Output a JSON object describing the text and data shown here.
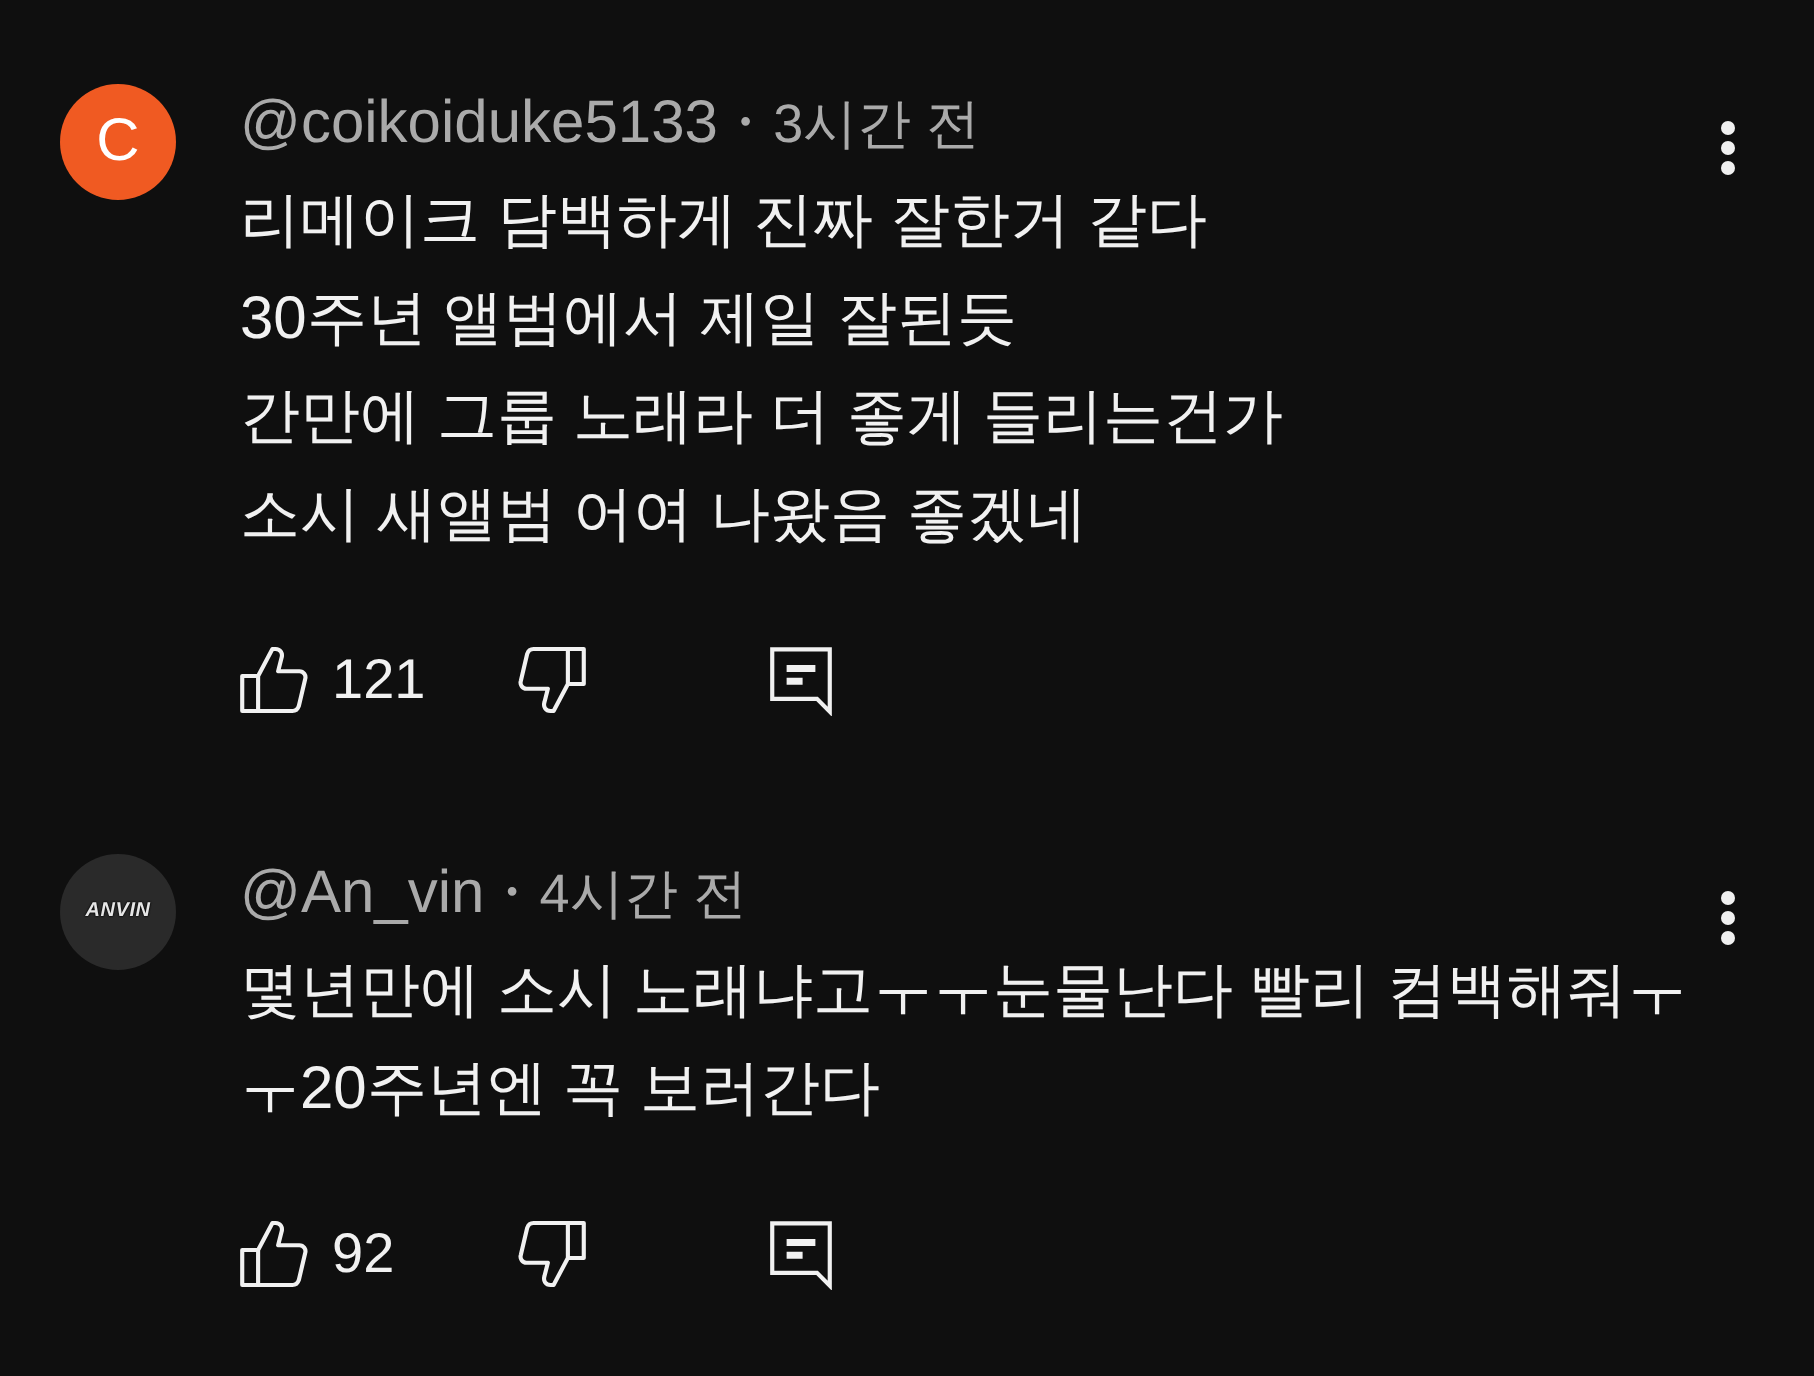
{
  "comments": [
    {
      "avatar": {
        "kind": "letter",
        "text": "C",
        "color": "#f05a22"
      },
      "author": "@coikoiduke5133",
      "separator": "•",
      "time": "3시간 전",
      "text_lines": [
        "리메이크 담백하게 진짜 잘한거 같다",
        "30주년 앨범에서 제일 잘된듯",
        "간만에 그룹 노래라 더 좋게 들리는건가",
        "소시 새앨범 어여 나왔음 좋겠네"
      ],
      "likes": "121"
    },
    {
      "avatar": {
        "kind": "logo",
        "text": "ANVIN",
        "color": "#2a2a2a"
      },
      "author": "@An_vin",
      "separator": "•",
      "time": "4시간 전",
      "text_lines": [
        "몇년만에 소시 노래냐고ㅜㅜ눈물난다 빨리 컴백해줘ㅜ",
        "ㅜ20주년엔 꼭 보러간다"
      ],
      "likes": "92"
    }
  ]
}
